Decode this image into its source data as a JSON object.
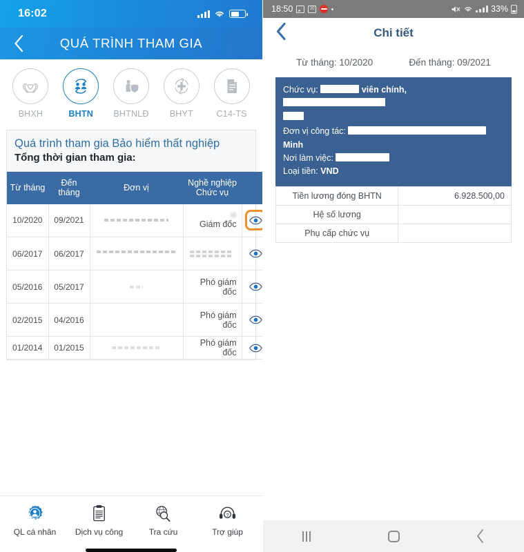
{
  "left_phone": {
    "status_bar": {
      "time": "16:02",
      "signal_icon": "signal-bars-icon",
      "wifi_icon": "wifi-icon",
      "battery_icon": "battery-icon"
    },
    "nav": {
      "back_icon": "chevron-left-icon",
      "title": "QUÁ TRÌNH THAM GIA"
    },
    "categories": [
      {
        "label": "BHXH",
        "icon": "hands-heart-icon",
        "active": false
      },
      {
        "label": "BHTN",
        "icon": "two-people-arrows-icon",
        "active": true
      },
      {
        "label": "BHTNLĐ",
        "icon": "worker-shield-icon",
        "active": false
      },
      {
        "label": "BHYT",
        "icon": "medical-cross-arrows-icon",
        "active": false
      },
      {
        "label": "C14-TS",
        "icon": "document-lines-icon",
        "active": false
      }
    ],
    "panel": {
      "title": "Quá trình tham gia Bảo hiểm thất nghiệp",
      "subtitle": "Tổng thời gian tham gia:",
      "columns": [
        "Từ tháng",
        "Đến tháng",
        "Đơn vị",
        "Nghề nghiệp Chức vụ"
      ],
      "columns_split": [
        {
          "line1": "Từ tháng",
          "line2": ""
        },
        {
          "line1": "Đến",
          "line2": "tháng"
        },
        {
          "line1": "Đơn vị",
          "line2": ""
        },
        {
          "line1": "Nghề nghiệp",
          "line2": "Chức vụ"
        }
      ],
      "rows": [
        {
          "from": "10/2020",
          "to": "09/2021",
          "unit": "",
          "job": "Giám đốc",
          "job_extra": "ıó",
          "eye_icon": "eye-icon",
          "highlighted": true
        },
        {
          "from": "06/2017",
          "to": "06/2017",
          "unit": "",
          "job": "",
          "job_extra": "",
          "eye_icon": "eye-icon",
          "highlighted": false
        },
        {
          "from": "05/2016",
          "to": "05/2017",
          "unit": "",
          "job": "Phó giám đốc",
          "job_extra": "",
          "eye_icon": "eye-icon",
          "highlighted": false
        },
        {
          "from": "02/2015",
          "to": "04/2016",
          "unit": "",
          "job": "Phó giám đốc",
          "job_extra": "",
          "eye_icon": "eye-icon",
          "highlighted": false
        },
        {
          "from": "01/2014",
          "to": "01/2015",
          "unit": "",
          "job": "Phó giám đốc",
          "job_extra": "",
          "eye_icon": "eye-icon",
          "highlighted": false
        }
      ]
    },
    "tabbar": [
      {
        "label": "QL cá nhân",
        "icon": "person-gear-icon",
        "active": true
      },
      {
        "label": "Dịch vụ công",
        "icon": "clipboard-icon",
        "active": false
      },
      {
        "label": "Tra cứu",
        "icon": "magnifier-globe-icon",
        "active": false
      },
      {
        "label": "Trợ giúp",
        "icon": "headset-help-icon",
        "active": false
      }
    ],
    "home_indicator": "home-indicator"
  },
  "right_phone": {
    "status_bar": {
      "time": "18:50",
      "battery_percent": "33%",
      "icons": [
        "image-icon",
        "calendar-icon",
        "alarm-icon",
        "dot-icon"
      ],
      "right_icons": [
        "mute-icon",
        "wifi-icon",
        "signal-bars-icon",
        "battery-icon"
      ]
    },
    "appbar": {
      "back_icon": "chevron-left-icon",
      "title": "Chi tiết"
    },
    "date_range": {
      "from_label": "Từ tháng: 10/2020",
      "to_label": "Đến tháng: 09/2021"
    },
    "info_card": {
      "position_label": "Chức vụ:",
      "position_value": "viên chính,",
      "unit_label": "Đơn vị công tác:",
      "unit_value": "Minh",
      "workplace_label": "Nơi làm việc:",
      "currency_label": "Loại tiền:",
      "currency_value": "VND",
      "redacted": true
    },
    "detail_table": {
      "rows": [
        {
          "label": "Tiền lương đóng BHTN",
          "value": "6.928.500,00"
        },
        {
          "label": "Hệ số lương",
          "value": ""
        },
        {
          "label": "Phụ cấp chức vụ",
          "value": ""
        }
      ]
    },
    "navbar": [
      {
        "icon": "recents-icon",
        "name": "recents-button"
      },
      {
        "icon": "home-icon",
        "name": "home-button"
      },
      {
        "icon": "back-icon",
        "name": "back-button"
      }
    ]
  },
  "colors": {
    "ios_header_blue": "#1b8ddd",
    "table_header_blue": "#3a6ba4",
    "card_blue": "#3b6193",
    "accent_orange": "#f0922b",
    "android_status_gray": "#7b7b7b",
    "title_blue": "#37597f"
  }
}
